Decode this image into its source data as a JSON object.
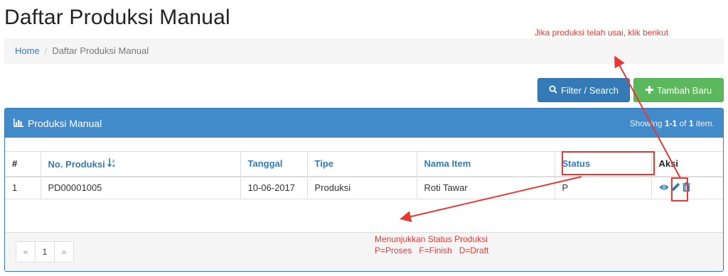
{
  "page": {
    "title": "Daftar Produksi Manual"
  },
  "breadcrumb": {
    "home": "Home",
    "separator": "/",
    "current": "Daftar Produksi Manual"
  },
  "toolbar": {
    "filter_label": "Filter / Search",
    "add_label": "Tambah Baru"
  },
  "panel": {
    "title": "Produksi Manual",
    "summary_prefix": "Showing ",
    "summary_range": "1-1",
    "summary_mid": " of ",
    "summary_total": "1",
    "summary_suffix": " item."
  },
  "table": {
    "columns": [
      "#",
      "No. Produksi",
      "Tanggal",
      "Tipe",
      "Nama Item",
      "Status",
      "Aksi"
    ],
    "rows": [
      {
        "no": "1",
        "no_produksi": "PD00001005",
        "tanggal": "10-06-2017",
        "tipe": "Produksi",
        "nama_item": "Roti Tawar",
        "status": "P"
      }
    ]
  },
  "pagination": {
    "prev": "«",
    "page": "1",
    "next": "»"
  },
  "annotations": {
    "top_note": "Jika produksi telah usai, klik berikut",
    "status_note_1": "Menunjukkan Status Produksi",
    "status_note_2": "P=Proses   F=Finish   D=Draft"
  },
  "colors": {
    "primary": "#337ab7",
    "success": "#5cb85c",
    "panel_heading": "#428bca",
    "annotation": "#e53935"
  }
}
